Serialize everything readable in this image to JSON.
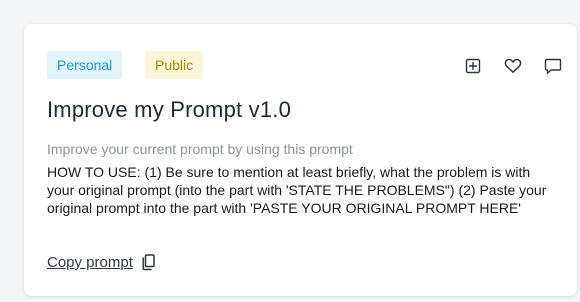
{
  "card": {
    "badges": {
      "personal": "Personal",
      "public": "Public"
    },
    "actions": {
      "add_icon": "plus-square-icon",
      "favorite_icon": "heart-icon",
      "comment_icon": "comment-icon"
    },
    "title": "Improve my Prompt v1.0",
    "subtitle": "Improve your current prompt by using this prompt",
    "description": "HOW TO USE: (1) Be sure to mention at least briefly, what the problem is with your original prompt (into the part with 'STATE THE PROBLEMS\") (2) Paste your original prompt into the part with 'PASTE YOUR ORIGINAL PROMPT HERE'",
    "copy_label": "Copy prompt",
    "copy_icon": "copy-icon"
  },
  "colors": {
    "personal_badge_bg": "#e1f4fb",
    "personal_badge_text": "#1f9ad6",
    "public_badge_bg": "#fbf6d9",
    "public_badge_text": "#a98e00",
    "title_text": "#1a2a3a",
    "subtitle_text": "#8b949e"
  }
}
